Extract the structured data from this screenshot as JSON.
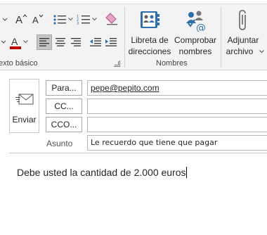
{
  "ribbon": {
    "basic_text_group": {
      "label": "exto básico",
      "font_color": "#c00000"
    },
    "names_group": {
      "label": "Nombres",
      "address_book": {
        "line1": "Libreta de",
        "line2": "direcciones"
      },
      "check_names": {
        "line1": "Comprobar",
        "line2": "nombres"
      }
    },
    "attach": {
      "line1": "Adjuntar",
      "line2": "archivo"
    }
  },
  "compose": {
    "send_label": "Enviar",
    "to_button": "Para...",
    "cc_button": "CC...",
    "bcc_button": "CCO...",
    "to_value": "pepe@pepito.com",
    "cc_value": "",
    "bcc_value": "",
    "subject_label": "Asunto",
    "subject_value": "Le recuerdo que tiene que pagar",
    "body_text": "Debe usted la cantidad de 2.000 euros"
  },
  "colors": {
    "ribbon_bg": "#f3f3f3",
    "accent_blue": "#2b6cb0",
    "font_color_red": "#c00000"
  }
}
